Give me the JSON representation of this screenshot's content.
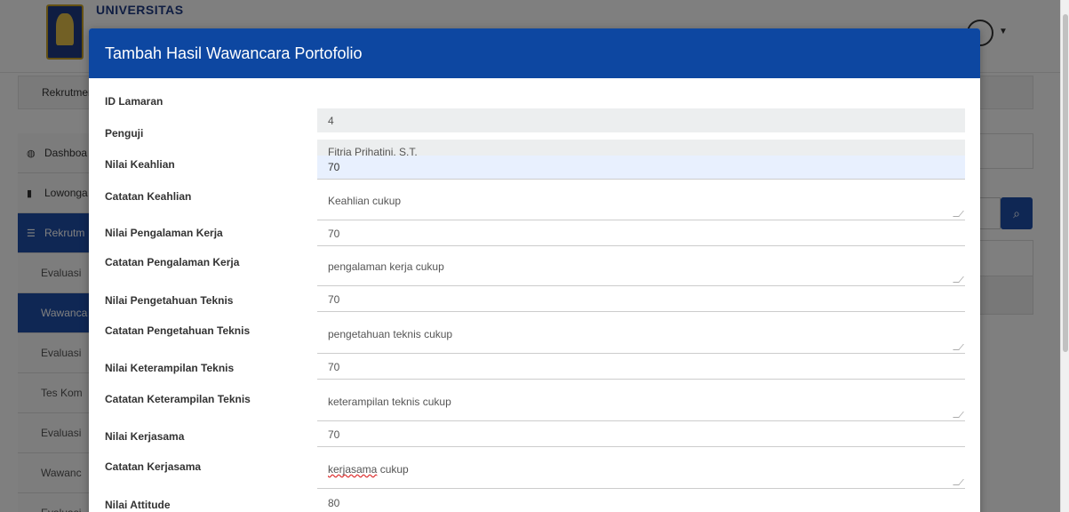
{
  "app": {
    "brand": "UNIVERSITAS",
    "breadcrumb": "Rekrutmen",
    "sidebar": {
      "items": [
        {
          "label": "Dashboa",
          "icon": "dashboard-icon"
        },
        {
          "label": "Lowonga",
          "icon": "briefcase-icon"
        },
        {
          "label": "Rekrutm",
          "icon": "list-icon"
        }
      ],
      "subitems": [
        "Evaluasi",
        "Wawanca",
        "Evaluasi",
        "Tes Kom",
        "Evaluasi",
        "Wawanc",
        "Evaluasi"
      ]
    },
    "search_icon": "search-icon"
  },
  "modal": {
    "title": "Tambah Hasil Wawancara Portofolio",
    "fields": [
      {
        "label": "ID Lamaran",
        "value": "4"
      },
      {
        "label": "Penguji",
        "value": "Fitria Prihatini, S.T."
      },
      {
        "label": "Nilai Keahlian",
        "value": "70"
      },
      {
        "label": "Catatan Keahlian",
        "value": "Keahlian cukup"
      },
      {
        "label": "Nilai Pengalaman Kerja",
        "value": "70"
      },
      {
        "label": "Catatan Pengalaman Kerja",
        "value": "pengalaman kerja cukup"
      },
      {
        "label": "Nilai Pengetahuan Teknis",
        "value": "70"
      },
      {
        "label": "Catatan Pengetahuan Teknis",
        "value": "pengetahuan teknis cukup"
      },
      {
        "label": "Nilai Keterampilan Teknis",
        "value": "70"
      },
      {
        "label": "Catatan Keterampilan Teknis",
        "value": "keterampilan teknis cukup"
      },
      {
        "label": "Nilai Kerjasama",
        "value": "70"
      },
      {
        "label": "Catatan Kerjasama",
        "value_word1": "kerjasama",
        "value_word2": "cukup"
      },
      {
        "label": "Nilai Attitude",
        "value": "80"
      }
    ]
  }
}
